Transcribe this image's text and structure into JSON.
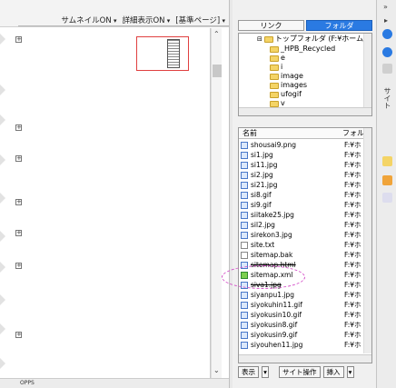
{
  "toolbar": {
    "thumbnail_label": "サムネイルON",
    "detail_label": "詳細表示ON",
    "base_page_label": "[基準ページ]"
  },
  "panel": {
    "tabs": [
      "リンク",
      "フォルダ"
    ],
    "active_tab": 1,
    "side_label": "サイト",
    "tree": {
      "root": "トップフォルダ (F:¥ホームペ",
      "children": [
        "_HPB_Recycled",
        "e",
        "i",
        "image",
        "images",
        "ufogif",
        "v"
      ]
    },
    "files": {
      "columns": [
        "名前",
        "フォル"
      ],
      "rows": [
        {
          "name": "shousai9.png",
          "path": "F:¥ホ",
          "kind": "img"
        },
        {
          "name": "si1.jpg",
          "path": "F:¥ホ",
          "kind": "img"
        },
        {
          "name": "si11.jpg",
          "path": "F:¥ホ",
          "kind": "img"
        },
        {
          "name": "si2.jpg",
          "path": "F:¥ホ",
          "kind": "img"
        },
        {
          "name": "si21.jpg",
          "path": "F:¥ホ",
          "kind": "img"
        },
        {
          "name": "si8.gif",
          "path": "F:¥ホ",
          "kind": "img"
        },
        {
          "name": "si9.gif",
          "path": "F:¥ホ",
          "kind": "img"
        },
        {
          "name": "siitake25.jpg",
          "path": "F:¥ホ",
          "kind": "img"
        },
        {
          "name": "sil2.jpg",
          "path": "F:¥ホ",
          "kind": "img"
        },
        {
          "name": "sirekon3.jpg",
          "path": "F:¥ホ",
          "kind": "img"
        },
        {
          "name": "site.txt",
          "path": "F:¥ホ",
          "kind": "txt"
        },
        {
          "name": "sitemap.bak",
          "path": "F:¥ホ",
          "kind": "txt"
        },
        {
          "name": "sitemap.html",
          "path": "F:¥ホ",
          "kind": "img"
        },
        {
          "name": "sitemap.xml",
          "path": "F:¥ホ",
          "kind": "html"
        },
        {
          "name": "siva1.jpg",
          "path": "F:¥ホ",
          "kind": "img"
        },
        {
          "name": "siyanpu1.jpg",
          "path": "F:¥ホ",
          "kind": "img"
        },
        {
          "name": "siyokuhin11.gif",
          "path": "F:¥ホ",
          "kind": "img"
        },
        {
          "name": "siyokusin10.gif",
          "path": "F:¥ホ",
          "kind": "img"
        },
        {
          "name": "siyokusin8.gif",
          "path": "F:¥ホ",
          "kind": "img"
        },
        {
          "name": "siyokusin9.gif",
          "path": "F:¥ホ",
          "kind": "img"
        },
        {
          "name": "siyouhen11.jpg",
          "path": "F:¥ホ",
          "kind": "img"
        }
      ]
    },
    "buttons": {
      "view": "表示",
      "site_ops": "サイト操作",
      "insert": "挿入"
    }
  },
  "bottombar": {
    "label": "OPPS"
  },
  "colors": {
    "accent": "#2a7ae2",
    "highlight_circle": "#d44fc8"
  }
}
